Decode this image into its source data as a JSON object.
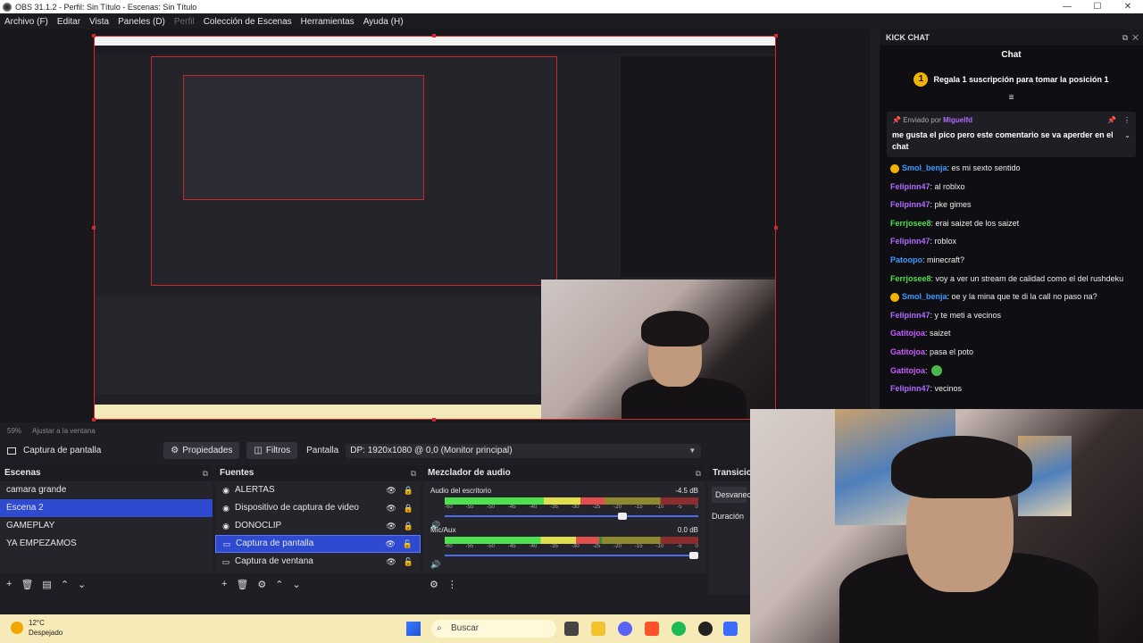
{
  "titlebar": {
    "title": "OBS 31.1.2 - Perfil: Sin Título - Escenas: Sin Título",
    "minimize": "—",
    "maximize": "☐",
    "close": "✕"
  },
  "menu": [
    "Archivo (F)",
    "Editar",
    "Vista",
    "Paneles (D)",
    "Perfil",
    "Colección de Escenas",
    "Herramientas",
    "Ayuda (H)"
  ],
  "zoombar": {
    "zoom": "59%",
    "fit": "Ajustar a la ventana"
  },
  "source_bar": {
    "source_name": "Captura de pantalla",
    "properties": "Propiedades",
    "filters": "Filtros",
    "display_label": "Pantalla",
    "display_value": "DP: 1920x1080 @ 0,0 (Monitor principal)"
  },
  "scenes": {
    "title": "Escenas",
    "items": [
      "camara grande",
      "Escena 2",
      "GAMEPLAY",
      "YA EMPEZAMOS"
    ],
    "selected": 1
  },
  "sources": {
    "title": "Fuentes",
    "items": [
      "ALERTAS",
      "Dispositivo de captura de video",
      "DONOCLIP",
      "Captura de pantalla",
      "Captura de ventana"
    ],
    "selected": 3
  },
  "mixer": {
    "title": "Mezclador de audio",
    "channels": [
      {
        "name": "Audio del escritorio",
        "db": "-4.5 dB",
        "level": 0.63,
        "fader": 0.72
      },
      {
        "name": "Mic/Aux",
        "db": "0.0 dB",
        "level": 0.61,
        "fader": 1.0
      }
    ],
    "scale": [
      "-60",
      "-55",
      "-50",
      "-45",
      "-40",
      "-35",
      "-30",
      "-25",
      "-20",
      "-15",
      "-10",
      "-5",
      "0"
    ]
  },
  "transitions": {
    "title": "Transicio",
    "fade": "Desvanec",
    "duration": "Duración"
  },
  "chat": {
    "panel_title": "KICK CHAT",
    "title": "Chat",
    "goal": "Regala 1 suscripción para tomar la posición 1",
    "goal_rank": "1",
    "pinned_by_label": "Enviado por",
    "pinned_user": "Miguelfd",
    "pinned_msg": "me gusta el pico pero este comentario se va aperder en el chat",
    "messages": [
      {
        "user": "Smol_benja",
        "text": ": es mi sexto sentido",
        "color": "#3b9bff",
        "sub": true
      },
      {
        "user": "Felipinn47",
        "text": ": al roblxo",
        "color": "#b06bff"
      },
      {
        "user": "Felipinn47",
        "text": ": pke gimes",
        "color": "#b06bff"
      },
      {
        "user": "Ferrjosee8",
        "text": ": erai saizet de los saizet",
        "color": "#4ee04e"
      },
      {
        "user": "Felipinn47",
        "text": ": roblox",
        "color": "#b06bff"
      },
      {
        "user": "Patoopo",
        "text": ": minecraft?",
        "color": "#3b9bff"
      },
      {
        "user": "Ferrjosee8",
        "text": ": voy a ver un stream de calidad como el del rushdeku",
        "color": "#4ee04e"
      },
      {
        "user": "Smol_benja",
        "text": ": oe y la mina que te di la call no paso na?",
        "color": "#3b9bff",
        "sub": true
      },
      {
        "user": "Felipinn47",
        "text": ": y te meti a vecinos",
        "color": "#b06bff"
      },
      {
        "user": "Gatitojoa",
        "text": ": saizet",
        "color": "#c45cff"
      },
      {
        "user": "Gatitojoa",
        "text": ": pasa el poto",
        "color": "#c45cff"
      },
      {
        "user": "Gatitojoa",
        "text": ":",
        "color": "#c45cff",
        "emote": true
      },
      {
        "user": "Felipinn47",
        "text": ": vecinos",
        "color": "#b06bff"
      }
    ]
  },
  "taskbar": {
    "temp": "12°C",
    "weather": "Despejado",
    "search": "Buscar"
  }
}
